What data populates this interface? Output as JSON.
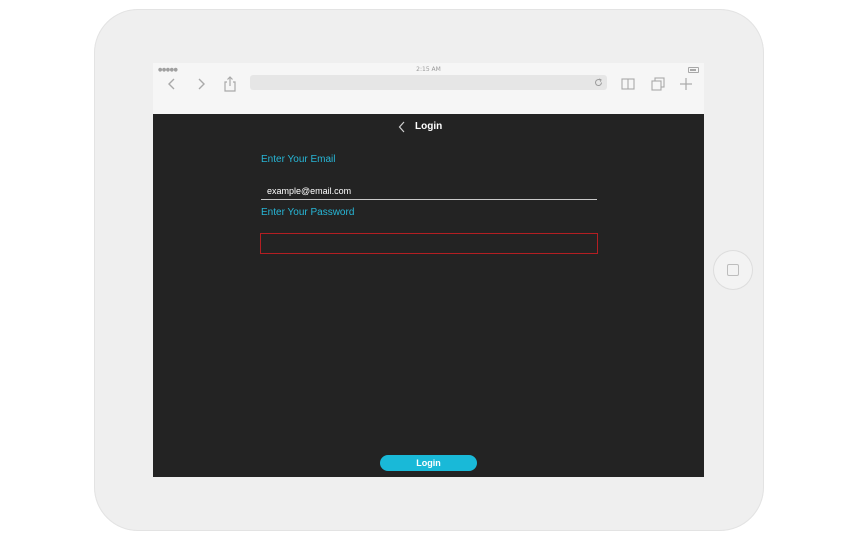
{
  "status_bar": {
    "time": "2:15 AM",
    "signal": "●●●●●"
  },
  "safari": {
    "back_icon": "chevron-left-icon",
    "forward_icon": "chevron-right-icon",
    "share_icon": "share-icon",
    "reload_icon": "reload-icon",
    "bookmarks_icon": "book-icon",
    "tabs_icon": "tabs-icon",
    "new_tab_icon": "plus-icon"
  },
  "app": {
    "nav_title": "Login",
    "email_label": "Enter Your Email",
    "email_value": "example@email.com",
    "password_label": "Enter Your Password",
    "password_value": "",
    "login_button": "Login"
  },
  "colors": {
    "accent": "#27b6d6",
    "button": "#19b9d8",
    "error_border": "#b31e22",
    "app_background": "#232323"
  }
}
